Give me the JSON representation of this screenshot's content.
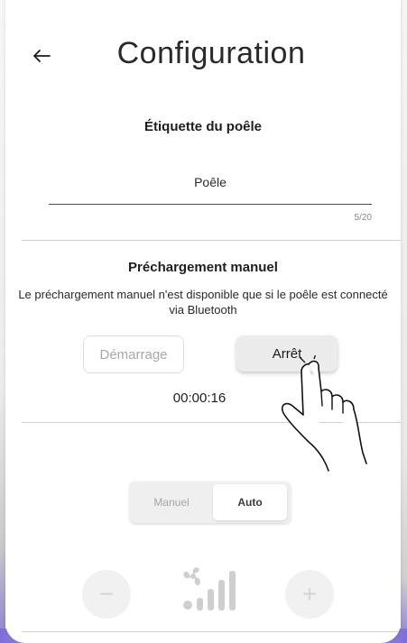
{
  "header": {
    "title": "Configuration",
    "back_icon": "arrow-left-icon"
  },
  "label_section": {
    "heading": "Étiquette du poêle",
    "value": "Poêle",
    "counter": "5/20"
  },
  "preload_section": {
    "heading": "Préchargement manuel",
    "description": "Le préchargement manuel n'est disponible que si le poêle est connecté via Bluetooth",
    "start_label": "Démarrage",
    "stop_label": "Arrêt",
    "timer": "00:00:16"
  },
  "mode": {
    "manual_label": "Manuel",
    "auto_label": "Auto",
    "selected": "Auto"
  },
  "fan": {
    "minus_label": "−",
    "plus_label": "+",
    "icon": "fan-power-icon"
  },
  "colors": {
    "accent_gradient": "#7b6fd6",
    "divider": "#cfcfcf"
  }
}
